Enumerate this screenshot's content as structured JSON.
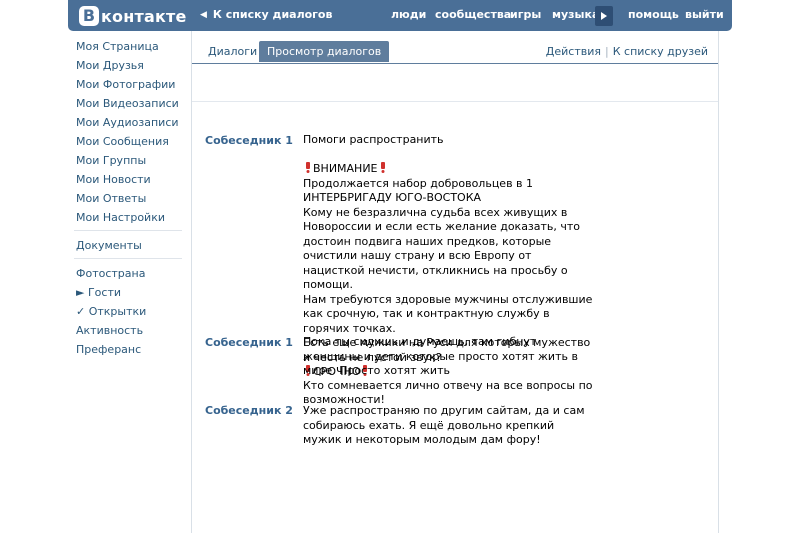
{
  "header": {
    "logo_letter": "В",
    "logo_text": "контакте",
    "back_link": "К списку диалогов",
    "nav": [
      "люди",
      "сообщества",
      "игры",
      "музыка",
      "помощь",
      "выйти"
    ],
    "accent_color": "#4a6f97"
  },
  "left_menu": {
    "group1": [
      "Моя Страница",
      "Мои Друзья",
      "Мои Фотографии",
      "Мои Видеозаписи",
      "Мои Аудиозаписи",
      "Мои Сообщения",
      "Мои Группы",
      "Мои Новости",
      "Мои Ответы",
      "Мои Настройки"
    ],
    "group2": [
      "Документы"
    ],
    "group3": [
      "Фотострана",
      "► Гости",
      "✓ Открытки",
      "Активность",
      "Преферанс"
    ]
  },
  "tabs": {
    "dialogs": "Диалоги",
    "view": "Просмотр диалогов",
    "actions": "Действия",
    "friends_list": "К списку друзей"
  },
  "messages": [
    {
      "author": "Собеседник 1",
      "lines": [
        "Помоги распространить"
      ]
    },
    {
      "author": "",
      "lines": [
        "ВНИМАНИЕ",
        "Продолжается набор добровольцев в 1 ИНТЕРБРИГАДУ ЮГО-ВОСТОКА",
        "Кому не безразлична судьба всех живущих в Новороссии и если есть желание доказать, что достоин подвига наших предков, которые очистили нашу страну и всю Европу от нацисткой нечисти, откликнись на просьбу о помощи.",
        "Нам требуются здоровые мужчины отслужившие как срочную, так и контрактную службу в горячих точках.",
        "Есть еще мужики на Руси для которых мужество и честь не пустой звук?",
        "СРОЧНО"
      ]
    },
    {
      "author": "Собеседник 1",
      "lines": [
        "Пока ты сидишь и думаешь, там гибнут женщины и дети которые просто хотят жить в мире. Просто хотят жить",
        "Кто сомневается лично отвечу на все вопросы по возможности!"
      ]
    },
    {
      "author": "Собеседник 2",
      "lines": [
        "Уже распространяю по другим сайтам, да и сам собираюсь ехать. Я ещё довольно крепкий мужик и некоторым молодым дам фору!"
      ]
    }
  ]
}
